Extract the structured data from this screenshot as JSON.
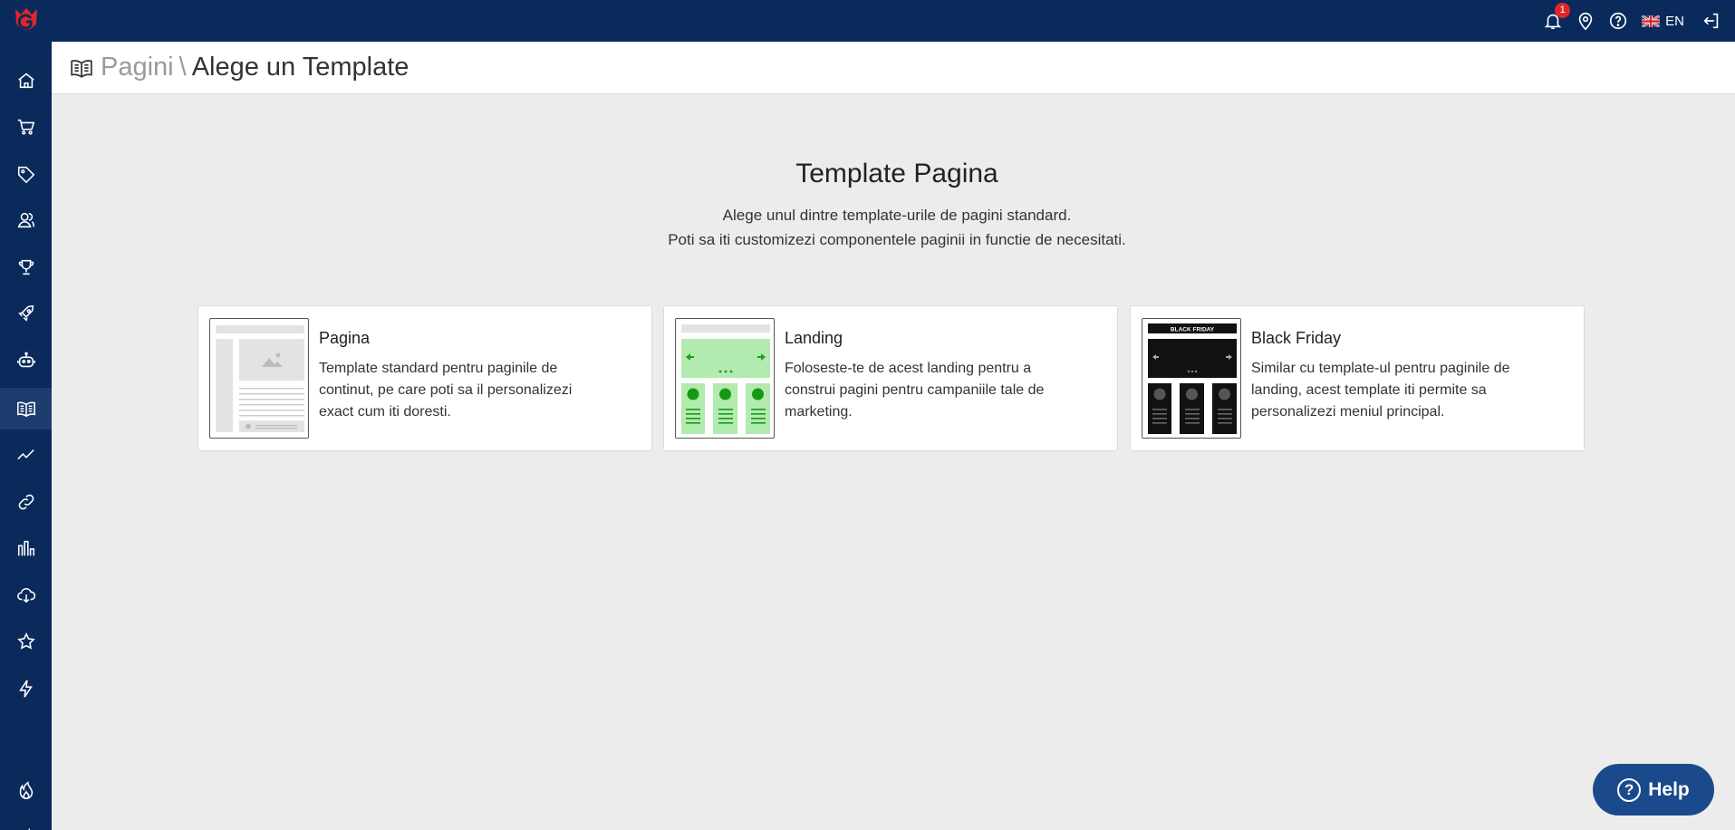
{
  "app": {
    "brand_color": "#0a2a5b",
    "logo_letter": "G",
    "logo_color": "#e0262b"
  },
  "topbar": {
    "notifications_count": "1",
    "language": "EN",
    "icons": [
      "bell-icon",
      "location-pin-icon",
      "help-circle-icon",
      "uk-flag-icon",
      "logout-icon"
    ]
  },
  "sidebar": {
    "items": [
      {
        "icon": "home-icon"
      },
      {
        "icon": "cart-icon"
      },
      {
        "icon": "tag-icon"
      },
      {
        "icon": "users-icon"
      },
      {
        "icon": "trophy-icon"
      },
      {
        "icon": "rocket-icon"
      },
      {
        "icon": "robot-icon"
      },
      {
        "icon": "book-icon",
        "active": true
      },
      {
        "icon": "trend-icon"
      },
      {
        "icon": "link-icon"
      },
      {
        "icon": "bar-chart-icon"
      },
      {
        "icon": "cloud-download-icon"
      },
      {
        "icon": "star-icon"
      },
      {
        "icon": "bolt-icon"
      },
      {
        "icon": "fire-icon"
      },
      {
        "icon": "magic-wand-icon"
      }
    ]
  },
  "breadcrumb": {
    "parent": "Pagini",
    "separator": "\\",
    "current": "Alege un Template"
  },
  "hero": {
    "title": "Template Pagina",
    "line1": "Alege unul dintre template-urile de pagini standard.",
    "line2": "Poti sa iti customizezi componentele paginii in functie de necesitati."
  },
  "cards": [
    {
      "title": "Pagina",
      "description": "Template standard pentru paginile de continut, pe care poti sa il personalizezi exact cum iti doresti."
    },
    {
      "title": "Landing",
      "description": "Foloseste-te de acest landing pentru a construi pagini pentru campaniile tale de marketing."
    },
    {
      "title": "Black Friday",
      "description": "Similar cu template-ul pentru paginile de landing, acest template iti permite sa personalizezi meniul principal.",
      "banner": "BLACK FRIDAY"
    }
  ],
  "help_button": {
    "label": "Help",
    "color": "#1a4a8c"
  }
}
